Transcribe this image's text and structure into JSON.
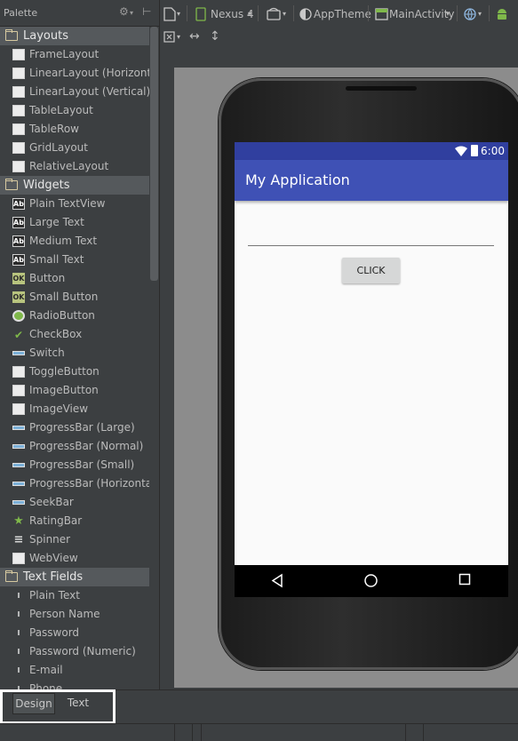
{
  "palette": {
    "title": "Palette",
    "categories": [
      {
        "label": "Layouts",
        "items": [
          {
            "label": "FrameLayout",
            "icon": "frame-layout-icon"
          },
          {
            "label": "LinearLayout (Horizontal)",
            "icon": "linear-layout-horizontal-icon"
          },
          {
            "label": "LinearLayout (Vertical)",
            "icon": "linear-layout-vertical-icon"
          },
          {
            "label": "TableLayout",
            "icon": "table-layout-icon"
          },
          {
            "label": "TableRow",
            "icon": "table-row-icon"
          },
          {
            "label": "GridLayout",
            "icon": "grid-layout-icon"
          },
          {
            "label": "RelativeLayout",
            "icon": "relative-layout-icon"
          }
        ]
      },
      {
        "label": "Widgets",
        "items": [
          {
            "label": "Plain TextView",
            "icon": "textview-icon"
          },
          {
            "label": "Large Text",
            "icon": "textview-icon"
          },
          {
            "label": "Medium Text",
            "icon": "textview-icon"
          },
          {
            "label": "Small Text",
            "icon": "textview-icon"
          },
          {
            "label": "Button",
            "icon": "button-icon"
          },
          {
            "label": "Small Button",
            "icon": "button-icon"
          },
          {
            "label": "RadioButton",
            "icon": "radio-button-icon"
          },
          {
            "label": "CheckBox",
            "icon": "checkbox-icon"
          },
          {
            "label": "Switch",
            "icon": "switch-icon"
          },
          {
            "label": "ToggleButton",
            "icon": "toggle-button-icon"
          },
          {
            "label": "ImageButton",
            "icon": "image-button-icon"
          },
          {
            "label": "ImageView",
            "icon": "image-view-icon"
          },
          {
            "label": "ProgressBar (Large)",
            "icon": "progress-bar-icon"
          },
          {
            "label": "ProgressBar (Normal)",
            "icon": "progress-bar-icon"
          },
          {
            "label": "ProgressBar (Small)",
            "icon": "progress-bar-icon"
          },
          {
            "label": "ProgressBar (Horizontal)",
            "icon": "progress-bar-icon"
          },
          {
            "label": "SeekBar",
            "icon": "seek-bar-icon"
          },
          {
            "label": "RatingBar",
            "icon": "rating-bar-icon"
          },
          {
            "label": "Spinner",
            "icon": "spinner-icon"
          },
          {
            "label": "WebView",
            "icon": "web-view-icon"
          }
        ]
      },
      {
        "label": "Text Fields",
        "items": [
          {
            "label": "Plain Text",
            "icon": "text-cursor-icon"
          },
          {
            "label": "Person Name",
            "icon": "text-cursor-icon"
          },
          {
            "label": "Password",
            "icon": "text-cursor-icon"
          },
          {
            "label": "Password (Numeric)",
            "icon": "text-cursor-icon"
          },
          {
            "label": "E-mail",
            "icon": "text-cursor-icon"
          },
          {
            "label": "Phone",
            "icon": "text-cursor-icon"
          }
        ]
      }
    ]
  },
  "toolbar": {
    "device": "Nexus 4",
    "theme": "AppTheme",
    "activity": "MainActivity"
  },
  "phone": {
    "time": "6:00",
    "app_title": "My Application",
    "button_label": "CLICK"
  },
  "tabs": {
    "design": "Design",
    "text": "Text"
  },
  "colors": {
    "status_bar": "#303f9f",
    "app_bar": "#3f51b5",
    "ide_background": "#3c3f41"
  }
}
